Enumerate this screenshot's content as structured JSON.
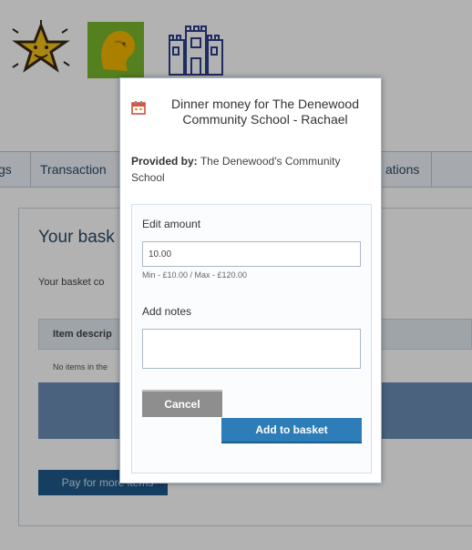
{
  "nav": {
    "item_partial_left": "gs",
    "item_transactions": "Transaction",
    "item_partial_right": "ations"
  },
  "basket": {
    "title": "Your bask",
    "text": "Your basket co",
    "table_header": "Item descrip",
    "table_empty": "No items in the",
    "pay_button": "Pay for more items"
  },
  "modal": {
    "title": "Dinner money for The Denewood Community School - Rachael",
    "provided_label": "Provided by:",
    "provided_value": "The Denewood's Community School",
    "edit_amount_label": "Edit amount",
    "amount_value": "10.00",
    "minmax_text": "Min - £10.00 / Max - £120.00",
    "add_notes_label": "Add notes",
    "notes_value": "",
    "cancel_label": "Cancel",
    "add_label": "Add to basket"
  },
  "colors": {
    "overlay": "rgba(0,0,0,0.30)",
    "add_button": "#2d7db8",
    "cancel_button": "#8e8e8e",
    "nav_text": "#2b4a66"
  },
  "icons": {
    "logos": [
      "star-logo-icon",
      "lion-logo-icon",
      "castle-logo-icon"
    ],
    "title_icon": "calendar-icon"
  }
}
